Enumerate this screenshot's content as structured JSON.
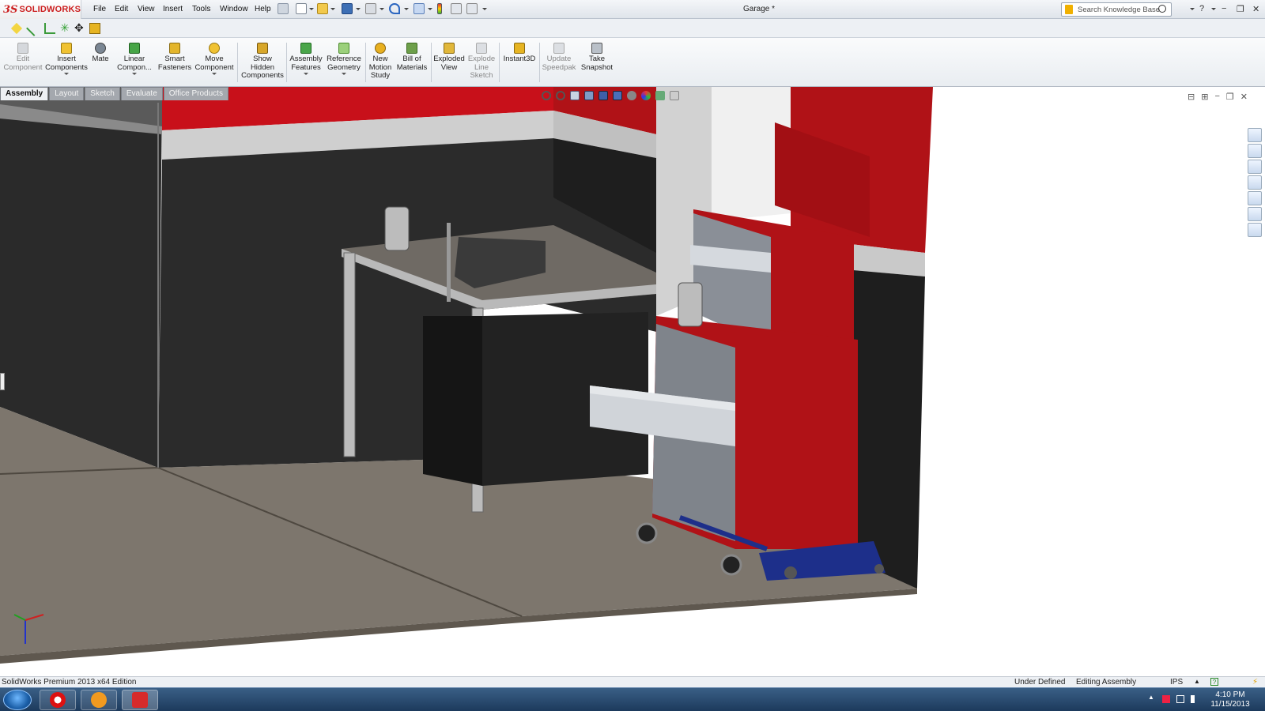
{
  "app": {
    "logo_ds": "3S",
    "logo_text": "SOLIDWORKS",
    "document_title": "Garage *"
  },
  "menu": [
    "File",
    "Edit",
    "View",
    "Insert",
    "Tools",
    "Window",
    "Help"
  ],
  "search": {
    "placeholder": "Search Knowledge Base"
  },
  "command_manager": [
    {
      "label": "Edit Component",
      "enabled": false
    },
    {
      "label": "Insert Components",
      "enabled": true
    },
    {
      "label": "Mate",
      "enabled": true
    },
    {
      "label": "Linear Compon...",
      "enabled": true
    },
    {
      "label": "Smart Fasteners",
      "enabled": true
    },
    {
      "label": "Move Component",
      "enabled": true
    },
    {
      "label": "Show Hidden Components",
      "enabled": true
    },
    {
      "label": "Assembly Features",
      "enabled": true
    },
    {
      "label": "Reference Geometry",
      "enabled": true
    },
    {
      "label": "New Motion Study",
      "enabled": true
    },
    {
      "label": "Bill of Materials",
      "enabled": true
    },
    {
      "label": "Exploded View",
      "enabled": true
    },
    {
      "label": "Explode Line Sketch",
      "enabled": false
    },
    {
      "label": "Instant3D",
      "enabled": true
    },
    {
      "label": "Update Speedpak",
      "enabled": false
    },
    {
      "label": "Take Snapshot",
      "enabled": true
    }
  ],
  "tabs": [
    {
      "label": "Assembly",
      "active": true
    },
    {
      "label": "Layout",
      "active": false
    },
    {
      "label": "Sketch",
      "active": false
    },
    {
      "label": "Evaluate",
      "active": false
    },
    {
      "label": "Office Products",
      "active": false
    }
  ],
  "status": {
    "edition": "SolidWorks Premium 2013 x64 Edition",
    "definition": "Under Defined",
    "mode": "Editing Assembly",
    "units": "IPS"
  },
  "taskbar": {
    "time": "4:10 PM",
    "date": "11/15/2013",
    "apps": [
      "start",
      "opera",
      "vlc",
      "solidworks"
    ]
  },
  "colors": {
    "toolbox_red": "#b01217",
    "wall_dark": "#2a2a2a",
    "floor": "#7d766d",
    "jack_blue": "#1d2f8a"
  }
}
